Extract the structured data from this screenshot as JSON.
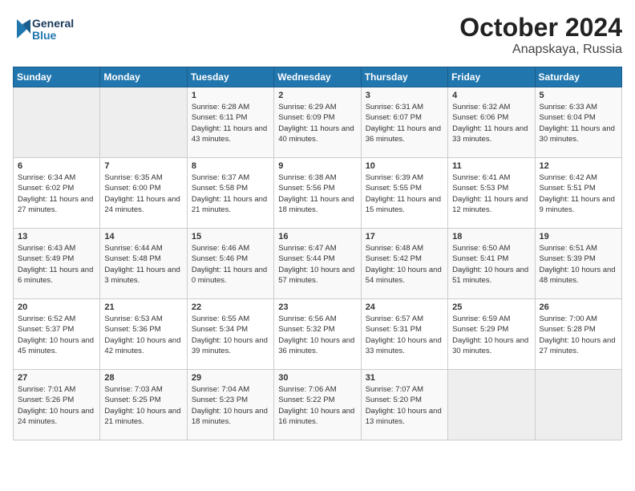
{
  "header": {
    "logo_line1": "General",
    "logo_line2": "Blue",
    "month": "October 2024",
    "location": "Anapskaya, Russia"
  },
  "weekdays": [
    "Sunday",
    "Monday",
    "Tuesday",
    "Wednesday",
    "Thursday",
    "Friday",
    "Saturday"
  ],
  "weeks": [
    [
      {
        "day": "",
        "info": ""
      },
      {
        "day": "",
        "info": ""
      },
      {
        "day": "1",
        "info": "Sunrise: 6:28 AM\nSunset: 6:11 PM\nDaylight: 11 hours and 43 minutes."
      },
      {
        "day": "2",
        "info": "Sunrise: 6:29 AM\nSunset: 6:09 PM\nDaylight: 11 hours and 40 minutes."
      },
      {
        "day": "3",
        "info": "Sunrise: 6:31 AM\nSunset: 6:07 PM\nDaylight: 11 hours and 36 minutes."
      },
      {
        "day": "4",
        "info": "Sunrise: 6:32 AM\nSunset: 6:06 PM\nDaylight: 11 hours and 33 minutes."
      },
      {
        "day": "5",
        "info": "Sunrise: 6:33 AM\nSunset: 6:04 PM\nDaylight: 11 hours and 30 minutes."
      }
    ],
    [
      {
        "day": "6",
        "info": "Sunrise: 6:34 AM\nSunset: 6:02 PM\nDaylight: 11 hours and 27 minutes."
      },
      {
        "day": "7",
        "info": "Sunrise: 6:35 AM\nSunset: 6:00 PM\nDaylight: 11 hours and 24 minutes."
      },
      {
        "day": "8",
        "info": "Sunrise: 6:37 AM\nSunset: 5:58 PM\nDaylight: 11 hours and 21 minutes."
      },
      {
        "day": "9",
        "info": "Sunrise: 6:38 AM\nSunset: 5:56 PM\nDaylight: 11 hours and 18 minutes."
      },
      {
        "day": "10",
        "info": "Sunrise: 6:39 AM\nSunset: 5:55 PM\nDaylight: 11 hours and 15 minutes."
      },
      {
        "day": "11",
        "info": "Sunrise: 6:41 AM\nSunset: 5:53 PM\nDaylight: 11 hours and 12 minutes."
      },
      {
        "day": "12",
        "info": "Sunrise: 6:42 AM\nSunset: 5:51 PM\nDaylight: 11 hours and 9 minutes."
      }
    ],
    [
      {
        "day": "13",
        "info": "Sunrise: 6:43 AM\nSunset: 5:49 PM\nDaylight: 11 hours and 6 minutes."
      },
      {
        "day": "14",
        "info": "Sunrise: 6:44 AM\nSunset: 5:48 PM\nDaylight: 11 hours and 3 minutes."
      },
      {
        "day": "15",
        "info": "Sunrise: 6:46 AM\nSunset: 5:46 PM\nDaylight: 11 hours and 0 minutes."
      },
      {
        "day": "16",
        "info": "Sunrise: 6:47 AM\nSunset: 5:44 PM\nDaylight: 10 hours and 57 minutes."
      },
      {
        "day": "17",
        "info": "Sunrise: 6:48 AM\nSunset: 5:42 PM\nDaylight: 10 hours and 54 minutes."
      },
      {
        "day": "18",
        "info": "Sunrise: 6:50 AM\nSunset: 5:41 PM\nDaylight: 10 hours and 51 minutes."
      },
      {
        "day": "19",
        "info": "Sunrise: 6:51 AM\nSunset: 5:39 PM\nDaylight: 10 hours and 48 minutes."
      }
    ],
    [
      {
        "day": "20",
        "info": "Sunrise: 6:52 AM\nSunset: 5:37 PM\nDaylight: 10 hours and 45 minutes."
      },
      {
        "day": "21",
        "info": "Sunrise: 6:53 AM\nSunset: 5:36 PM\nDaylight: 10 hours and 42 minutes."
      },
      {
        "day": "22",
        "info": "Sunrise: 6:55 AM\nSunset: 5:34 PM\nDaylight: 10 hours and 39 minutes."
      },
      {
        "day": "23",
        "info": "Sunrise: 6:56 AM\nSunset: 5:32 PM\nDaylight: 10 hours and 36 minutes."
      },
      {
        "day": "24",
        "info": "Sunrise: 6:57 AM\nSunset: 5:31 PM\nDaylight: 10 hours and 33 minutes."
      },
      {
        "day": "25",
        "info": "Sunrise: 6:59 AM\nSunset: 5:29 PM\nDaylight: 10 hours and 30 minutes."
      },
      {
        "day": "26",
        "info": "Sunrise: 7:00 AM\nSunset: 5:28 PM\nDaylight: 10 hours and 27 minutes."
      }
    ],
    [
      {
        "day": "27",
        "info": "Sunrise: 7:01 AM\nSunset: 5:26 PM\nDaylight: 10 hours and 24 minutes."
      },
      {
        "day": "28",
        "info": "Sunrise: 7:03 AM\nSunset: 5:25 PM\nDaylight: 10 hours and 21 minutes."
      },
      {
        "day": "29",
        "info": "Sunrise: 7:04 AM\nSunset: 5:23 PM\nDaylight: 10 hours and 18 minutes."
      },
      {
        "day": "30",
        "info": "Sunrise: 7:06 AM\nSunset: 5:22 PM\nDaylight: 10 hours and 16 minutes."
      },
      {
        "day": "31",
        "info": "Sunrise: 7:07 AM\nSunset: 5:20 PM\nDaylight: 10 hours and 13 minutes."
      },
      {
        "day": "",
        "info": ""
      },
      {
        "day": "",
        "info": ""
      }
    ]
  ]
}
